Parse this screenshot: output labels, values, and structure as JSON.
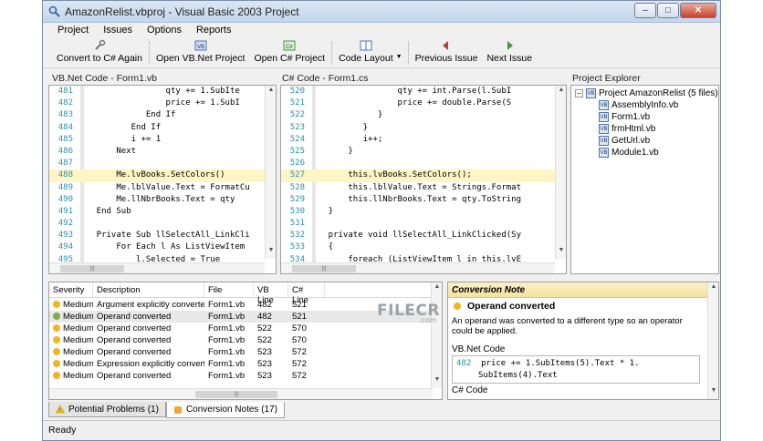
{
  "window": {
    "title": "AmazonRelist.vbproj - Visual Basic 2003 Project"
  },
  "menu": [
    "Project",
    "Issues",
    "Options",
    "Reports"
  ],
  "toolbar": {
    "convert": "Convert to C# Again",
    "open_vb": "Open VB.Net Project",
    "open_cs": "Open C# Project",
    "code_layout": "Code Layout",
    "prev_issue": "Previous Issue",
    "next_issue": "Next Issue"
  },
  "vb_pane": {
    "title": "VB.Net Code - Form1.vb",
    "lines": [
      {
        "n": "481",
        "code": "                qty += 1.SubIte"
      },
      {
        "n": "482",
        "code": "                price += 1.SubI"
      },
      {
        "n": "483",
        "code": "            End If"
      },
      {
        "n": "484",
        "code": "         End If"
      },
      {
        "n": "485",
        "code": "         i += 1"
      },
      {
        "n": "486",
        "code": "      Next"
      },
      {
        "n": "487",
        "code": ""
      },
      {
        "n": "488",
        "code": "      Me.lvBooks.SetColors()",
        "hl": true
      },
      {
        "n": "489",
        "code": "      Me.lblValue.Text = FormatCu"
      },
      {
        "n": "490",
        "code": "      Me.llNbrBooks.Text = qty"
      },
      {
        "n": "491",
        "code": "  End Sub"
      },
      {
        "n": "492",
        "code": ""
      },
      {
        "n": "493",
        "code": "  Private Sub llSelectAll_LinkCli"
      },
      {
        "n": "494",
        "code": "      For Each l As ListViewItem"
      },
      {
        "n": "495",
        "code": "          l.Selected = True"
      }
    ]
  },
  "cs_pane": {
    "title": "C# Code - Form1.cs",
    "lines": [
      {
        "n": "520",
        "code": "                qty += int.Parse(l.SubI"
      },
      {
        "n": "521",
        "code": "                price += double.Parse(S"
      },
      {
        "n": "522",
        "code": "            }"
      },
      {
        "n": "523",
        "code": "         }"
      },
      {
        "n": "524",
        "code": "         i++;"
      },
      {
        "n": "525",
        "code": "      }"
      },
      {
        "n": "526",
        "code": ""
      },
      {
        "n": "527",
        "code": "      this.lvBooks.SetColors();",
        "hl": true
      },
      {
        "n": "528",
        "code": "      this.lblValue.Text = Strings.Format"
      },
      {
        "n": "529",
        "code": "      this.llNbrBooks.Text = qty.ToString"
      },
      {
        "n": "530",
        "code": "  }"
      },
      {
        "n": "531",
        "code": ""
      },
      {
        "n": "532",
        "code": "  private void llSelectAll_LinkClicked(Sy"
      },
      {
        "n": "533",
        "code": "  {"
      },
      {
        "n": "534",
        "code": "      foreach (ListViewItem l in this.lvE"
      }
    ]
  },
  "explorer": {
    "title": "Project Explorer",
    "root": "Project AmazonRelist (5 files)",
    "files": [
      "AssemblyInfo.vb",
      "Form1.vb",
      "frmHtml.vb",
      "GetUrl.vb",
      "Module1.vb"
    ]
  },
  "issues": {
    "columns": [
      "Severity",
      "Description",
      "File",
      "VB Line",
      "C# Line"
    ],
    "rows": [
      {
        "severity": "Medium",
        "description": "Argument explicitly converted",
        "file": "Form1.vb",
        "vb": "482",
        "cs": "521"
      },
      {
        "severity": "Medium",
        "description": "Operand converted",
        "file": "Form1.vb",
        "vb": "482",
        "cs": "521"
      },
      {
        "severity": "Medium",
        "description": "Operand converted",
        "file": "Form1.vb",
        "vb": "522",
        "cs": "570"
      },
      {
        "severity": "Medium",
        "description": "Operand converted",
        "file": "Form1.vb",
        "vb": "522",
        "cs": "570"
      },
      {
        "severity": "Medium",
        "description": "Operand converted",
        "file": "Form1.vb",
        "vb": "523",
        "cs": "572"
      },
      {
        "severity": "Medium",
        "description": "Expression explicitly converted",
        "file": "Form1.vb",
        "vb": "523",
        "cs": "572"
      },
      {
        "severity": "Medium",
        "description": "Operand converted",
        "file": "Form1.vb",
        "vb": "523",
        "cs": "572"
      }
    ]
  },
  "note": {
    "header": "Conversion Note",
    "title": "Operand converted",
    "text": "An operand was converted to a different type so an operator could be applied.",
    "vb_label": "VB.Net Code",
    "vb_line": "482",
    "vb_code_1": "price += 1.SubItems(5).Text * 1.",
    "vb_code_2": "SubItems(4).Text",
    "cs_label": "C# Code"
  },
  "tabs": [
    "Potential Problems (1)",
    "Conversion Notes (17)"
  ],
  "status": "Ready",
  "watermark": {
    "main": "FILECR",
    "sub": ".com"
  },
  "colors": {
    "highlight": "#fdf5c4",
    "medium_dot": "#f2b51d",
    "selected_dot": "#7dae4a",
    "line_number": "#2b91af"
  }
}
